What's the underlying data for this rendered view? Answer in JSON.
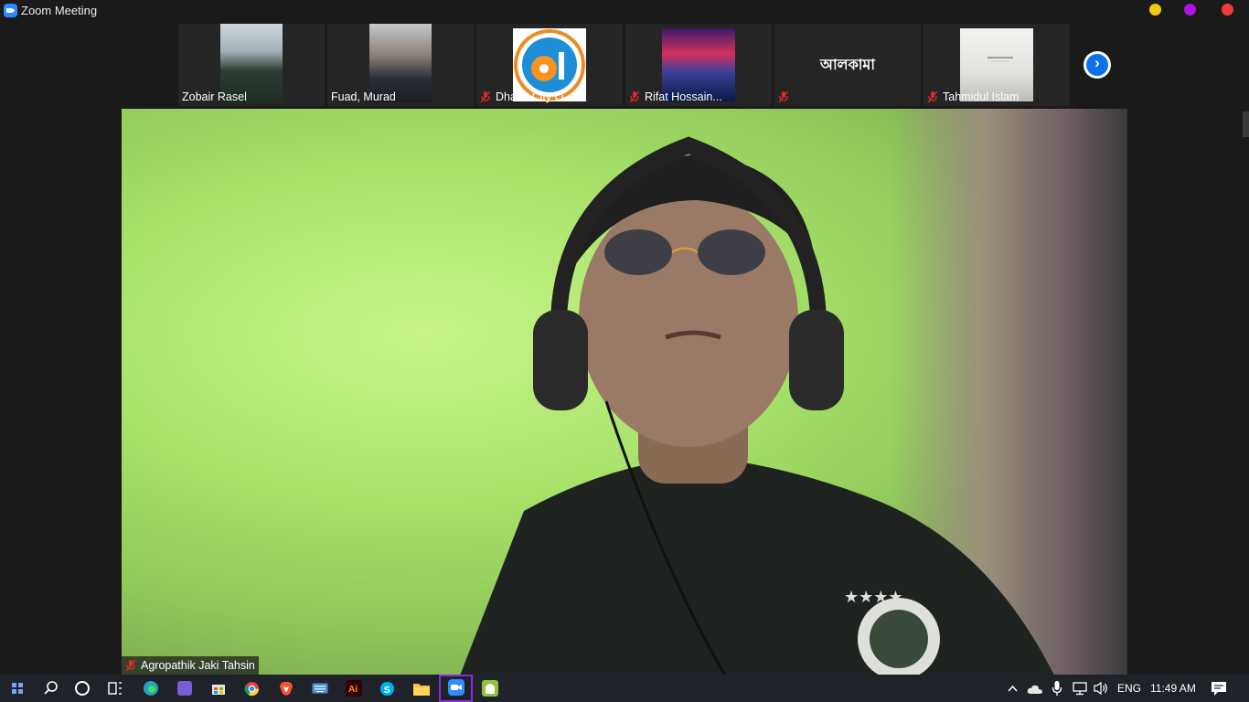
{
  "window": {
    "title": "Zoom Meeting",
    "colors": {
      "minimize": "#f6c90e",
      "maximize": "#b011e0",
      "close": "#ef3b3b"
    }
  },
  "gallery": {
    "participants": [
      {
        "name": "Zobair Rasel",
        "muted": false,
        "display": "video"
      },
      {
        "name": "Fuad, Murad",
        "muted": false,
        "display": "video"
      },
      {
        "name": "Dhaka City O...",
        "muted": true,
        "display": "logo"
      },
      {
        "name": "Rifat Hossain...",
        "muted": true,
        "display": "image"
      },
      {
        "name": "",
        "muted": true,
        "display": "text",
        "display_text": "আলকামা"
      },
      {
        "name": "Tahmidul Islam",
        "muted": true,
        "display": "image"
      }
    ],
    "next_icon": "chevron-right-icon"
  },
  "main_video": {
    "participant_name": "Agropathik Jaki Tahsin",
    "muted": true
  },
  "taskbar": {
    "apps": [
      "start",
      "search",
      "cortana",
      "task-view",
      "edge",
      "media",
      "store",
      "chrome",
      "brave",
      "keyboard",
      "illustrator",
      "skype",
      "file-explorer",
      "zoom",
      "android"
    ],
    "active_app": "zoom",
    "tray": {
      "language": "ENG",
      "time": "11:49 AM"
    }
  }
}
